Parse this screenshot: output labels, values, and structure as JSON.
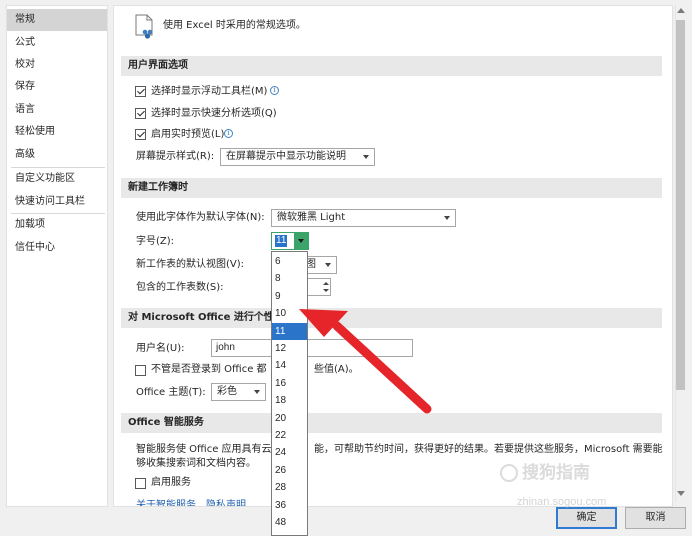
{
  "sidebar": {
    "items": [
      {
        "label": "常规",
        "selected": true
      },
      {
        "label": "公式"
      },
      {
        "label": "校对"
      },
      {
        "label": "保存"
      },
      {
        "label": "语言"
      },
      {
        "label": "轻松使用"
      },
      {
        "label": "高级"
      },
      {
        "label": "自定义功能区"
      },
      {
        "label": "快速访问工具栏"
      },
      {
        "label": "加载项"
      },
      {
        "label": "信任中心"
      }
    ]
  },
  "header": {
    "text": "使用 Excel 时采用的常规选项。"
  },
  "ui_options": {
    "title": "用户界面选项",
    "mini_toolbar": "选择时显示浮动工具栏(M)",
    "quick_analysis": "选择时显示快速分析选项(Q)",
    "live_preview": "启用实时预览(L)",
    "screentip_label": "屏幕提示样式(R):",
    "screentip_value": "在屏幕提示中显示功能说明"
  },
  "new_workbook": {
    "title": "新建工作簿时",
    "font_label": "使用此字体作为默认字体(N):",
    "font_value": "微软雅黑 Light",
    "size_label": "字号(Z):",
    "size_value": "11",
    "view_label": "新工作表的默认视图(V):",
    "view_value_tail": "图",
    "sheets_label": "包含的工作表数(S):"
  },
  "personalize": {
    "title_visible": "对 Microsoft Office 进行个性",
    "username_label": "用户名(U):",
    "username_value": "john",
    "always_use_pre": "不管是否登录到 Office 都",
    "always_use_post": "些值(A)。",
    "theme_label": "Office 主题(T):",
    "theme_value": "彩色"
  },
  "intelligent": {
    "title": "Office 智能服务",
    "desc_line1_pre": "智能服务使 Office 应用具有云",
    "desc_line1_post": "能，可帮助节约时间，获得更好的结果。若要提供这些服务，Microsoft 需要能",
    "desc_line2": "够收集搜索词和文档内容。",
    "enable_label": "启用服务",
    "link_about": "关于智能服务",
    "link_privacy": "隐私声明"
  },
  "dropdown": {
    "options": [
      "6",
      "8",
      "9",
      "10",
      "11",
      "12",
      "14",
      "16",
      "18",
      "20",
      "22",
      "24",
      "26",
      "28",
      "36",
      "48"
    ],
    "selected": "11"
  },
  "footer": {
    "ok": "确定",
    "cancel": "取消"
  },
  "watermark": {
    "text": "搜狗指南",
    "url": "zhinan.sogou.com"
  },
  "colors": {
    "arrow": "#e5252a",
    "selection": "#2a74c9",
    "dropdown_button": "#3aa46a"
  }
}
